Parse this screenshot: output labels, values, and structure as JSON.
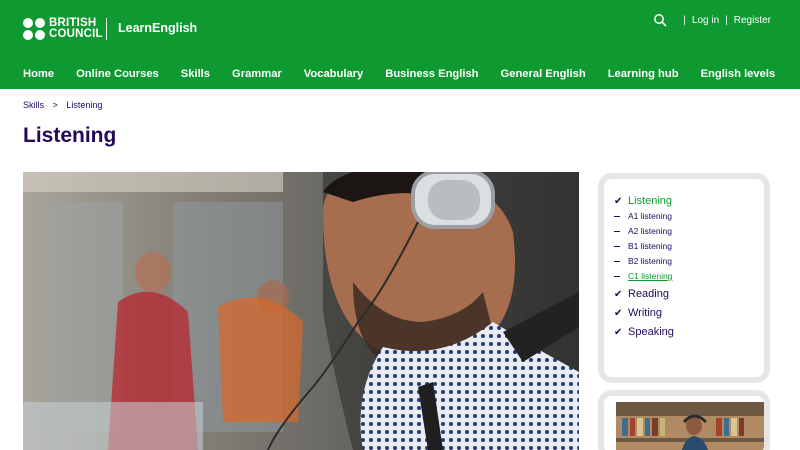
{
  "brand": {
    "logo_line1": "BRITISH",
    "logo_line2": "COUNCIL",
    "site_name": "LearnEnglish",
    "color_primary": "#0f9a31",
    "color_text": "#23085a"
  },
  "utility": {
    "search_icon": "search-icon",
    "login": "Log in",
    "register": "Register",
    "separator": "|"
  },
  "nav": {
    "items": [
      "Home",
      "Online Courses",
      "Skills",
      "Grammar",
      "Vocabulary",
      "Business English",
      "General English",
      "Learning hub",
      "English levels"
    ]
  },
  "breadcrumb": {
    "items": [
      "Skills",
      "Listening"
    ],
    "separator": ">"
  },
  "page": {
    "title": "Listening"
  },
  "sidebar": {
    "items": [
      {
        "label": "Listening",
        "mark": "✔"
      },
      {
        "label": "A1 listening"
      },
      {
        "label": "A2 listening"
      },
      {
        "label": "B1 listening"
      },
      {
        "label": "B2 listening"
      },
      {
        "label": "C1 listening"
      },
      {
        "label": "Reading",
        "mark": "✔"
      },
      {
        "label": "Writing",
        "mark": "✔"
      },
      {
        "label": "Speaking",
        "mark": "✔"
      }
    ]
  }
}
